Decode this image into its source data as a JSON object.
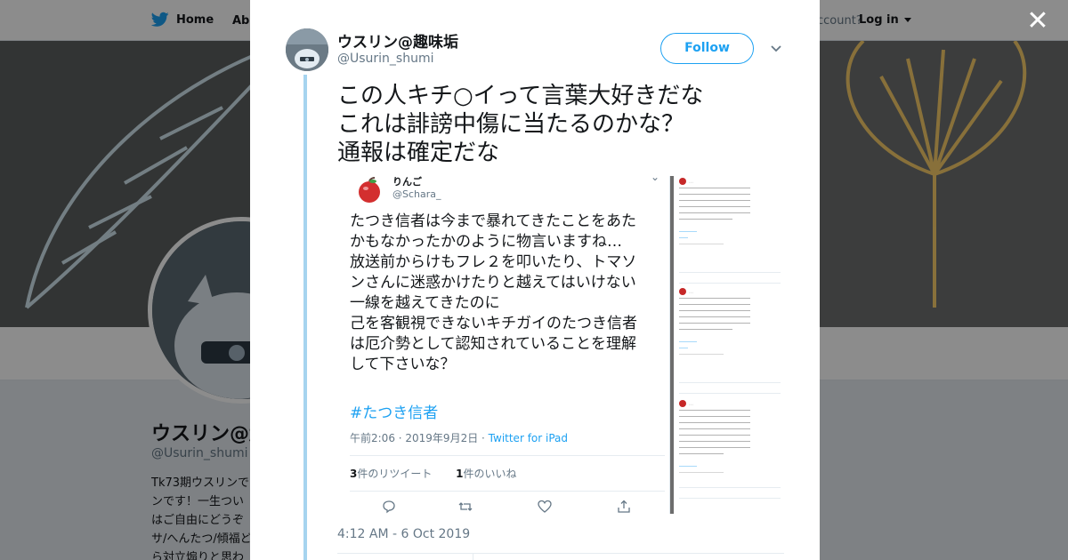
{
  "nav": {
    "home_label": "Home",
    "about_label": "Abo",
    "account_prompt": "ccount?",
    "login_label": "Log in"
  },
  "profile": {
    "name": "ウスリン@趣",
    "handle": "@Usurin_shumi",
    "bio_lines": [
      "Tk73期ウスリンで",
      "ンです！一生つい",
      "はご自由にどうぞ",
      "サ/へんたつ/傾福ど",
      "ら対立煽りと思わ"
    ]
  },
  "colors": {
    "twitter_blue": "#1da1f2",
    "thread_line": "#a6d4ef",
    "text_primary": "#14171a",
    "text_secondary": "#657786"
  },
  "tweet": {
    "author_name": "ウスリン@趣味垢",
    "author_handle": "@Usurin_shumi",
    "follow_label": "Follow",
    "text_lines": [
      "この人キチ○イって言葉大好きだな",
      "これは誹謗中傷に当たるのかな？",
      "通報は確定だな"
    ],
    "timestamp": "4:12 AM - 6 Oct 2019"
  },
  "quoted": {
    "name": "りんご",
    "handle": "@Schara_",
    "body_lines": [
      "たつき信者は今まで暴れてきたことをあた",
      "かもなかったかのように物言いますね…",
      "放送前からけもフレ２を叩いたり、トマソ",
      "ンさんに迷惑かけたりと越えてはいけない",
      "一線を越えてきたのに",
      "己を客観視できないキチガイのたつき信者",
      "は厄介勢として認知されていることを理解",
      "して下さいな？"
    ],
    "hashtag": "#たつき信者",
    "time": "午前2:06 · 2019年9月2日 · ",
    "source": "Twitter for iPad",
    "retweet_count": "3",
    "retweet_label": "件のリツイート",
    "like_count": "1",
    "like_label": "件のいいね"
  },
  "icons": {
    "twitter": "twitter-bird-icon",
    "close": "close-icon",
    "caret": "chevron-down-icon",
    "reply": "reply-icon",
    "retweet": "retweet-icon",
    "like": "heart-icon",
    "share": "share-icon"
  }
}
